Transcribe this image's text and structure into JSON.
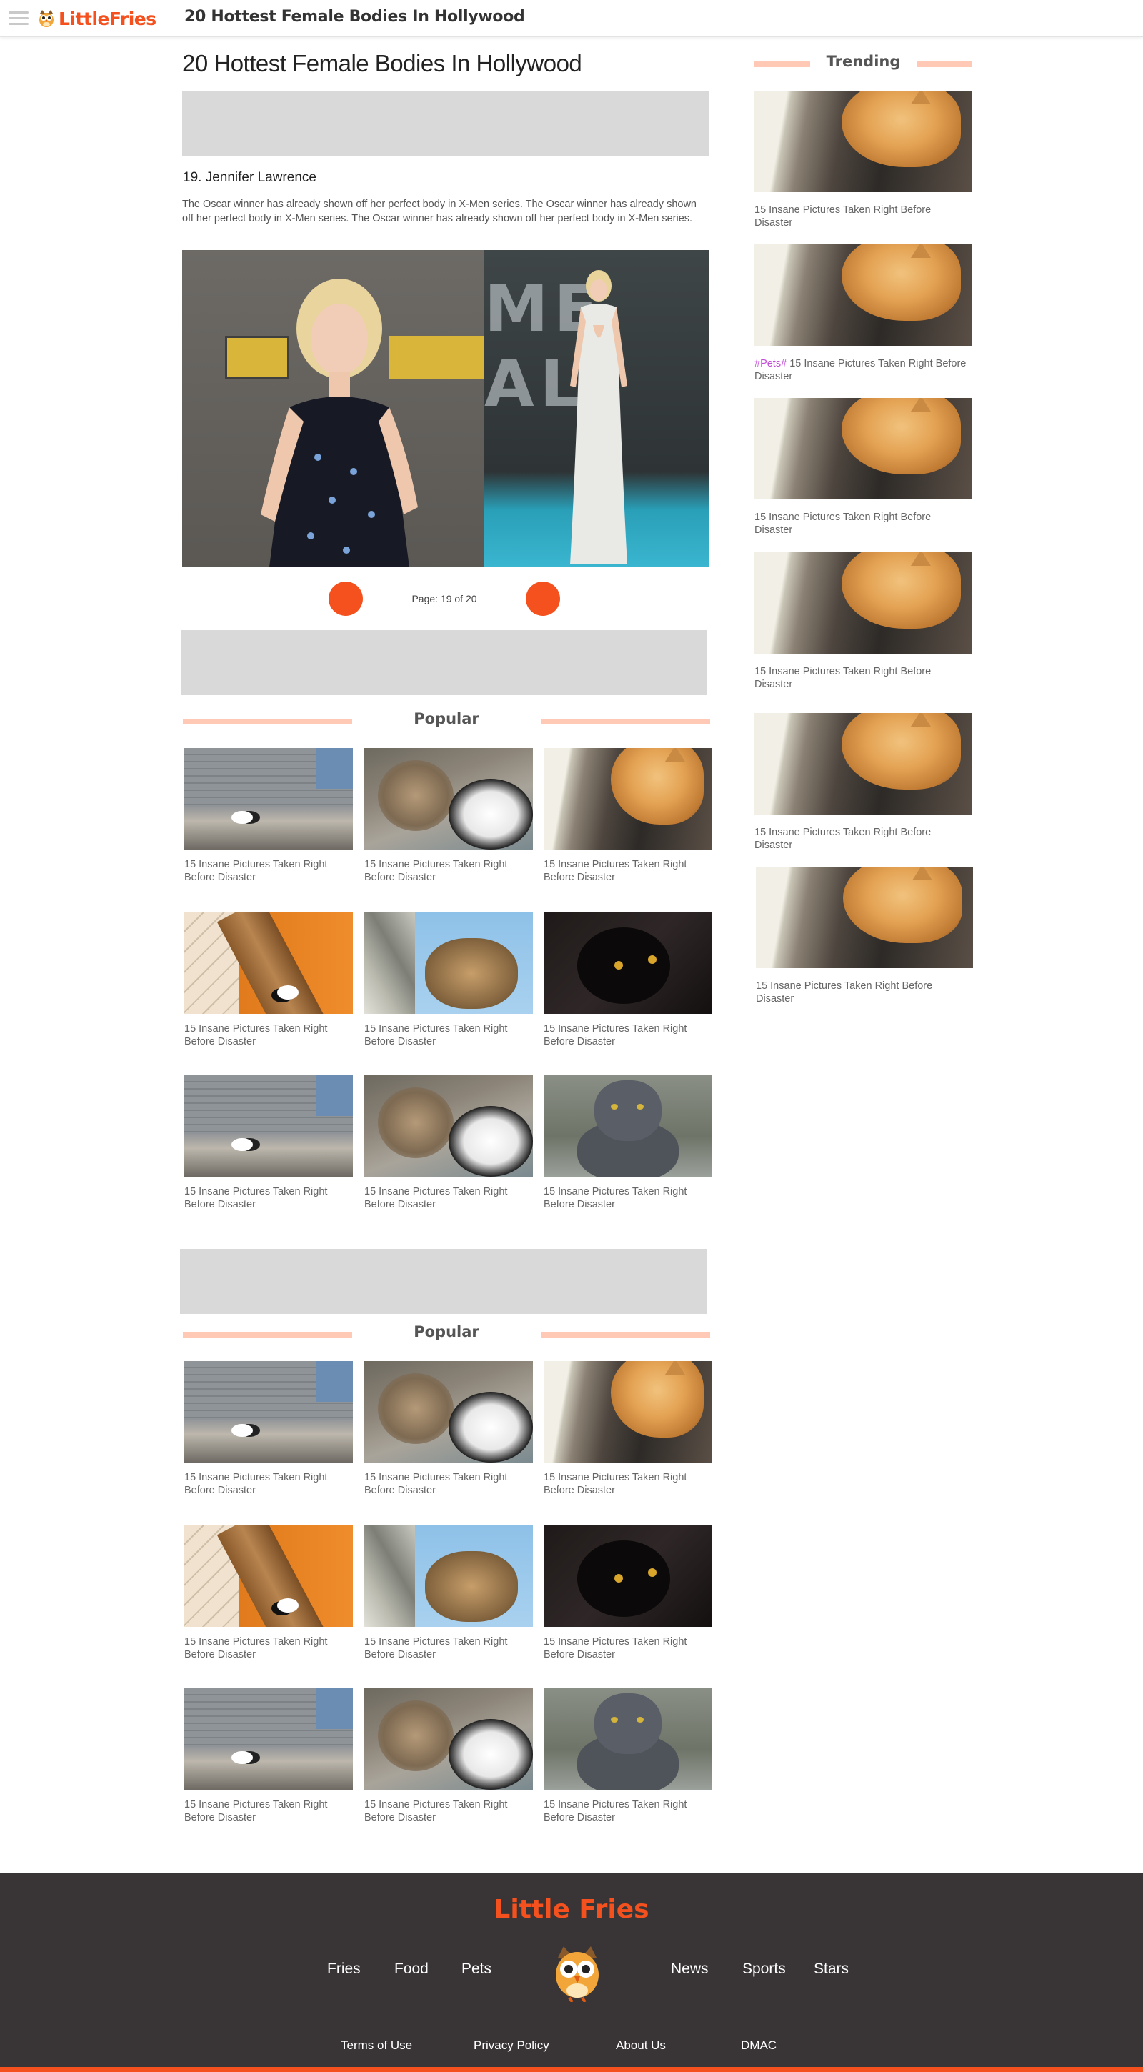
{
  "header": {
    "brand": "LittleFries",
    "title": "20 Hottest Female Bodies In Hollywood",
    "menu_icon": "hamburger-menu-icon",
    "logo_icon": "owl-icon"
  },
  "article": {
    "title": "20 Hottest Female Bodies In Hollywood",
    "item_heading": "19. Jennifer Lawrence",
    "item_description": "The Oscar winner has already shown off her perfect body in X-Men series. The Oscar winner has already shown off her perfect body in X-Men series. The Oscar winner has already shown off her perfect body in X-Men series.",
    "pager_text": "Page: 19 of 20"
  },
  "trending": {
    "title": "Trending",
    "items": [
      {
        "caption": "15 Insane Pictures Taken Right Before Disaster",
        "tag": ""
      },
      {
        "caption": "15 Insane Pictures Taken Right Before Disaster",
        "tag": "#Pets#"
      },
      {
        "caption": "15 Insane Pictures Taken Right Before Disaster",
        "tag": ""
      },
      {
        "caption": "15 Insane Pictures Taken Right Before Disaster",
        "tag": ""
      },
      {
        "caption": "15 Insane Pictures Taken Right Before Disaster",
        "tag": ""
      },
      {
        "caption": "15 Insane Pictures Taken Right Before Disaster",
        "tag": ""
      }
    ]
  },
  "popular1": {
    "title": "Popular",
    "items": [
      {
        "caption": "15 Insane Pictures Taken Right Before Disaster"
      },
      {
        "caption": "15 Insane Pictures Taken Right Before Disaster"
      },
      {
        "caption": "15 Insane Pictures Taken Right Before Disaster"
      },
      {
        "caption": "15 Insane Pictures Taken Right Before Disaster"
      },
      {
        "caption": "15 Insane Pictures Taken Right Before Disaster"
      },
      {
        "caption": "15 Insane Pictures Taken Right Before Disaster"
      },
      {
        "caption": "15 Insane Pictures Taken Right Before Disaster"
      },
      {
        "caption": "15 Insane Pictures Taken Right Before Disaster"
      },
      {
        "caption": "15 Insane Pictures Taken Right Before Disaster"
      }
    ]
  },
  "popular2": {
    "title": "Popular",
    "items": [
      {
        "caption": "15 Insane Pictures Taken Right Before Disaster"
      },
      {
        "caption": "15 Insane Pictures Taken Right Before Disaster"
      },
      {
        "caption": "15 Insane Pictures Taken Right Before Disaster"
      },
      {
        "caption": "15 Insane Pictures Taken Right Before Disaster"
      },
      {
        "caption": "15 Insane Pictures Taken Right Before Disaster"
      },
      {
        "caption": "15 Insane Pictures Taken Right Before Disaster"
      },
      {
        "caption": "15 Insane Pictures Taken Right Before Disaster"
      },
      {
        "caption": "15 Insane Pictures Taken Right Before Disaster"
      },
      {
        "caption": "15 Insane Pictures Taken Right Before Disaster"
      }
    ]
  },
  "footer": {
    "brand": "Little Fries",
    "nav_left": [
      "Fries",
      "Food",
      "Pets"
    ],
    "nav_right": [
      "News",
      "Sports",
      "Stars"
    ],
    "links": [
      "Terms of Use",
      "Privacy Policy",
      "About Us",
      "DMAC"
    ]
  },
  "colors": {
    "accent": "#f4511e",
    "section_bar": "#ffc9b5",
    "tag": "#c44ad9",
    "footer_bg": "#393536",
    "ad_placeholder": "#d9d9d9"
  }
}
